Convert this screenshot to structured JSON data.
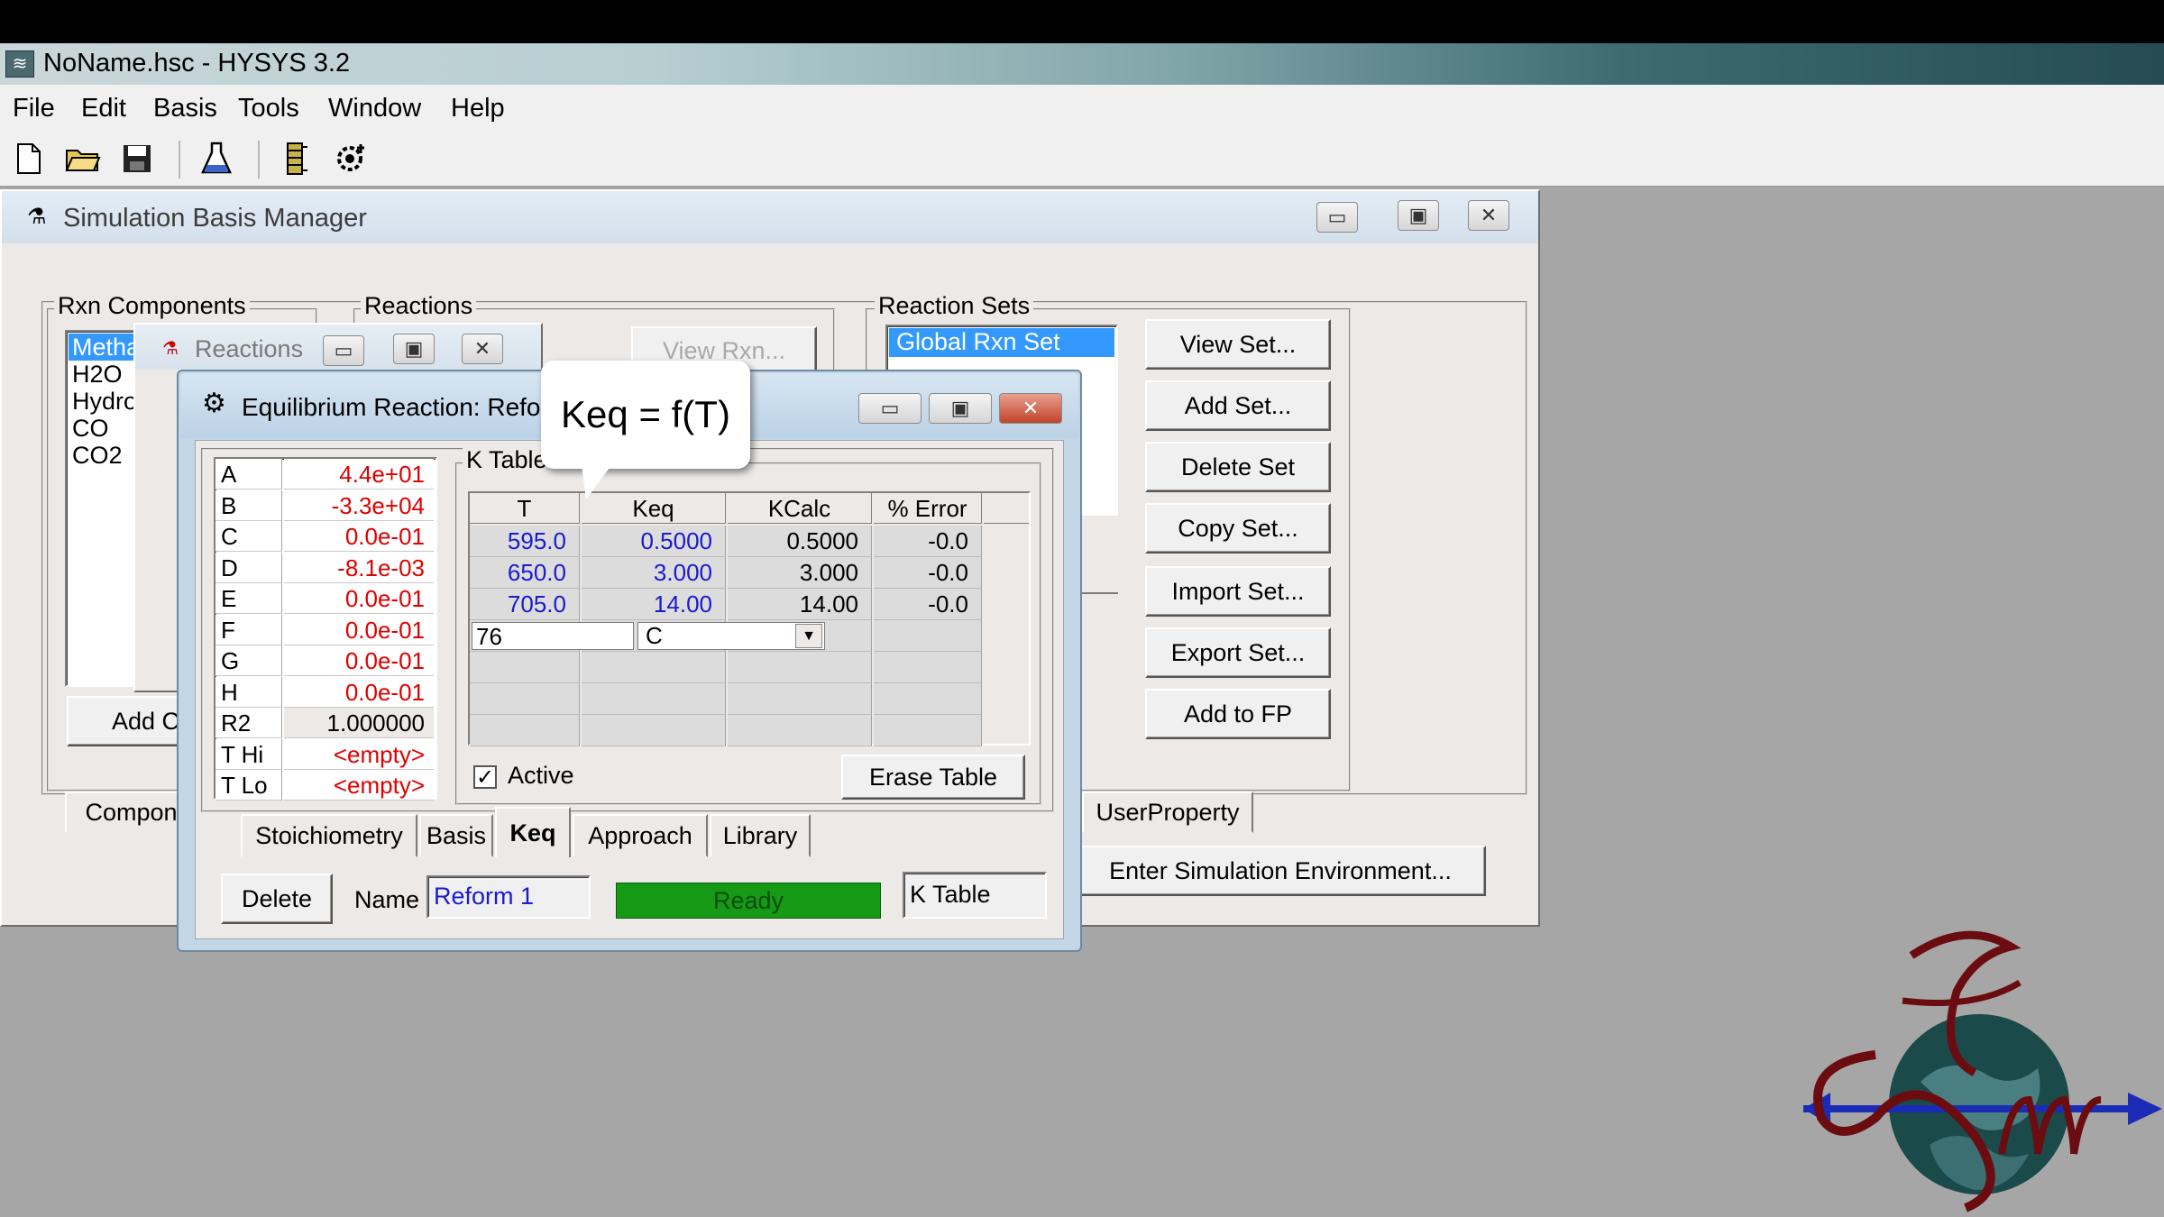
{
  "app": {
    "title": "NoName.hsc - HYSYS 3.2",
    "menu": [
      "File",
      "Edit",
      "Basis",
      "Tools",
      "Window",
      "Help"
    ],
    "toolbar_icons": [
      "new-file-icon",
      "open-folder-icon",
      "save-icon",
      "flask-icon",
      "column-icon",
      "oil-gear-icon"
    ]
  },
  "basis_manager": {
    "title": "Simulation Basis Manager",
    "rxn_components_label": "Rxn Components",
    "components": [
      "Metha",
      "H2O",
      "Hydro",
      "CO",
      "CO2"
    ],
    "add_comp_label": "Add C",
    "reactions_label": "Reactions",
    "view_rxn_label": "View Rxn...",
    "reaction_sets_label": "Reaction Sets",
    "reaction_sets": [
      "Global Rxn Set"
    ],
    "set_buttons": [
      "View Set...",
      "Add Set...",
      "Delete Set",
      "Copy Set...",
      "Import Set...",
      "Export Set...",
      "Add to FP"
    ],
    "tabs": [
      "Compone",
      "UserProperty"
    ],
    "enter_sim_label": "Enter Simulation Environment..."
  },
  "reactions_window": {
    "title": "Reactions"
  },
  "eq_reaction": {
    "title": "Equilibrium Reaction: Refor",
    "params": [
      {
        "name": "A",
        "value": "4.4e+01"
      },
      {
        "name": "B",
        "value": "-3.3e+04"
      },
      {
        "name": "C",
        "value": "0.0e-01"
      },
      {
        "name": "D",
        "value": "-8.1e-03"
      },
      {
        "name": "E",
        "value": "0.0e-01"
      },
      {
        "name": "F",
        "value": "0.0e-01"
      },
      {
        "name": "G",
        "value": "0.0e-01"
      },
      {
        "name": "H",
        "value": "0.0e-01"
      },
      {
        "name": "R2",
        "value": "1.000000"
      },
      {
        "name": "T Hi",
        "value": "<empty>"
      },
      {
        "name": "T Lo",
        "value": "<empty>"
      }
    ],
    "ktable_label": "K Table",
    "ktable_headers": [
      "T",
      "Keq",
      "KCalc",
      "% Error"
    ],
    "ktable_rows": [
      [
        "595.0",
        "0.5000",
        "0.5000",
        "-0.0"
      ],
      [
        "650.0",
        "3.000",
        "3.000",
        "-0.0"
      ],
      [
        "705.0",
        "14.00",
        "14.00",
        "-0.0"
      ]
    ],
    "edit_value": "76",
    "unit_value": "C",
    "active_label": "Active",
    "active_checked": true,
    "erase_label": "Erase Table",
    "tabs": [
      "Stoichiometry",
      "Basis",
      "Keq",
      "Approach",
      "Library"
    ],
    "active_tab": "Keq",
    "delete_label": "Delete",
    "name_label": "Name",
    "name_value": "Reform 1",
    "status": "Ready",
    "status_color": "#169a16",
    "ktable_combo": "K Table"
  },
  "callout": "Keq = f(T)"
}
